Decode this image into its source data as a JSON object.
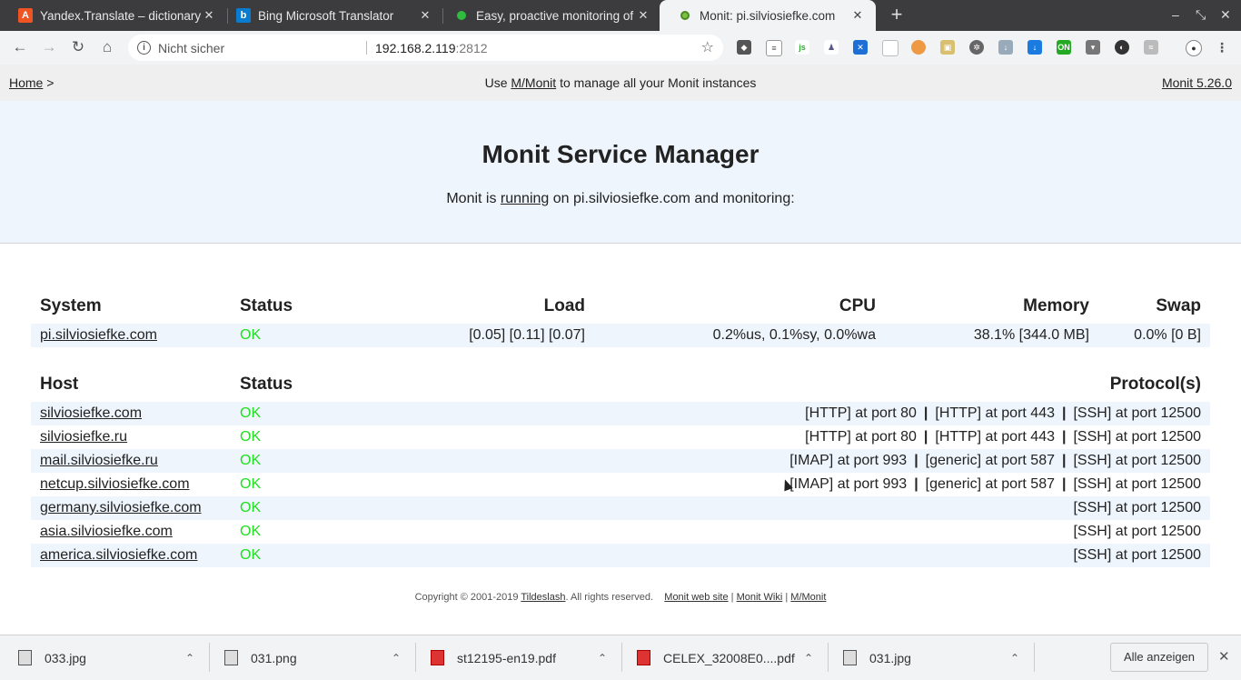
{
  "browser": {
    "tabs": [
      {
        "title": "Yandex.Translate – dictionary",
        "icon": "yandex-translate-icon",
        "active": false
      },
      {
        "title": "Bing Microsoft Translator",
        "icon": "bing-icon",
        "active": false
      },
      {
        "title": "Easy, proactive monitoring of",
        "icon": "green-dot-icon",
        "active": false
      },
      {
        "title": "Monit: pi.silviosiefke.com",
        "icon": "monit-icon",
        "active": true
      }
    ],
    "new_tab": "+",
    "omnibox": {
      "security_label": "Nicht sicher",
      "url_host": "192.168.2.119",
      "url_port": ":2812"
    }
  },
  "monit": {
    "header": {
      "home": "Home",
      "home_sep": ">",
      "center_prefix": "Use",
      "center_link": "M/Monit",
      "center_suffix": "to manage all your Monit instances",
      "version": "Monit 5.26.0"
    },
    "hero": {
      "title": "Monit Service Manager",
      "sub_prefix": "Monit is",
      "sub_link": "running",
      "sub_suffix": "on pi.silviosiefke.com and monitoring:"
    },
    "system_table": {
      "headers": [
        "System",
        "Status",
        "Load",
        "CPU",
        "Memory",
        "Swap"
      ],
      "rows": [
        {
          "name": "pi.silviosiefke.com",
          "status": "OK",
          "load": "[0.05] [0.11] [0.07]",
          "cpu": "0.2%us, 0.1%sy, 0.0%wa",
          "memory": "38.1% [344.0 MB]",
          "swap": "0.0% [0 B]"
        }
      ]
    },
    "host_table": {
      "headers": [
        "Host",
        "Status",
        "Protocol(s)"
      ],
      "rows": [
        {
          "name": "silviosiefke.com",
          "status": "OK",
          "protocols": [
            "[HTTP] at port 80",
            "[HTTP] at port 443",
            "[SSH] at port 12500"
          ]
        },
        {
          "name": "silviosiefke.ru",
          "status": "OK",
          "protocols": [
            "[HTTP] at port 80",
            "[HTTP] at port 443",
            "[SSH] at port 12500"
          ]
        },
        {
          "name": "mail.silviosiefke.ru",
          "status": "OK",
          "protocols": [
            "[IMAP] at port 993",
            "[generic] at port 587",
            "[SSH] at port 12500"
          ]
        },
        {
          "name": "netcup.silviosiefke.com",
          "status": "OK",
          "protocols": [
            "[IMAP] at port 993",
            "[generic] at port 587",
            "[SSH] at port 12500"
          ]
        },
        {
          "name": "germany.silviosiefke.com",
          "status": "OK",
          "protocols": [
            "[SSH] at port 12500"
          ]
        },
        {
          "name": "asia.silviosiefke.com",
          "status": "OK",
          "protocols": [
            "[SSH] at port 12500"
          ]
        },
        {
          "name": "america.silviosiefke.com",
          "status": "OK",
          "protocols": [
            "[SSH] at port 12500"
          ]
        }
      ]
    },
    "footer": {
      "copyright": "Copyright © 2001-2019",
      "company": "Tildeslash",
      "rights": ". All rights reserved.",
      "links": [
        "Monit web site",
        "Monit Wiki",
        "M/Monit"
      ]
    }
  },
  "downloads": {
    "items": [
      {
        "name": "033.jpg",
        "type": "image"
      },
      {
        "name": "031.png",
        "type": "image"
      },
      {
        "name": "st12195-en19.pdf",
        "type": "pdf"
      },
      {
        "name": "CELEX_32008E0....pdf",
        "type": "pdf"
      },
      {
        "name": "031.jpg",
        "type": "image"
      }
    ],
    "show_all": "Alle anzeigen"
  }
}
